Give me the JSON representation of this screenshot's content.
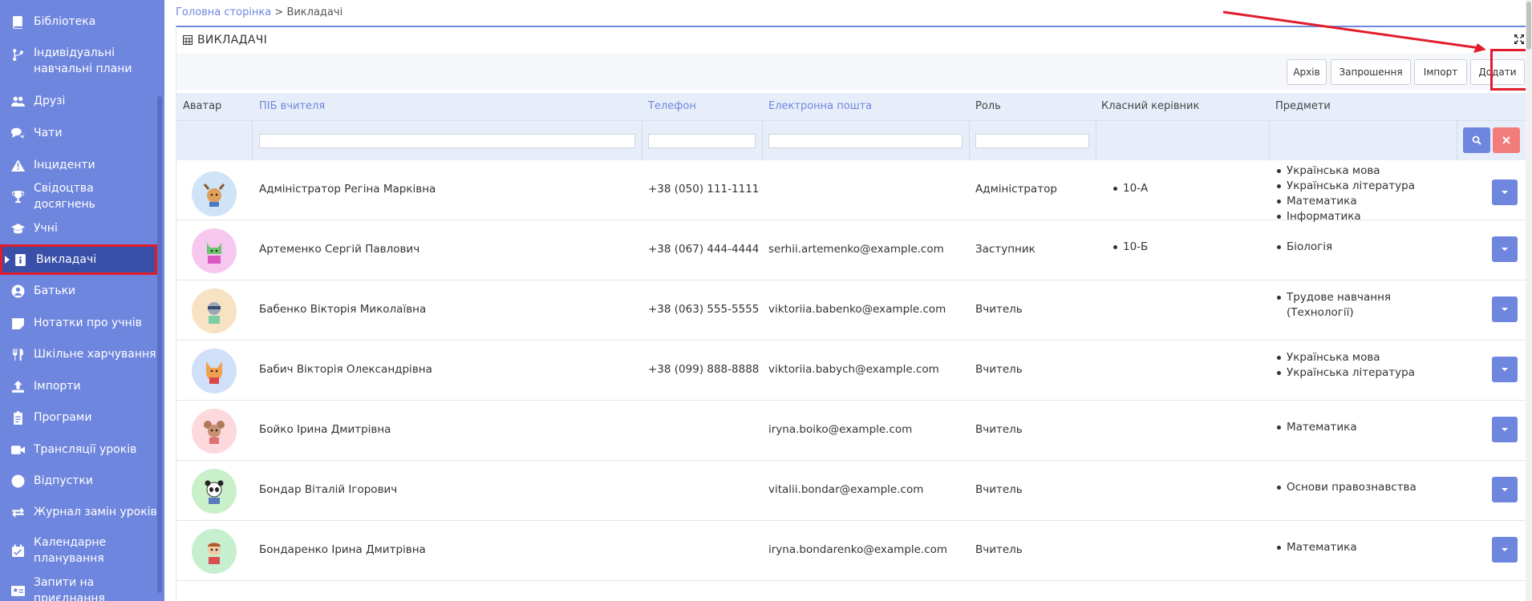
{
  "sidebar": {
    "items": [
      {
        "label": "Бібліотека",
        "icon": "book-icon"
      },
      {
        "label": "Індивідуальні навчальні плани",
        "icon": "branch-icon"
      },
      {
        "label": "Друзі",
        "icon": "users-icon"
      },
      {
        "label": "Чати",
        "icon": "chat-icon"
      },
      {
        "label": "Інциденти",
        "icon": "warning-icon"
      },
      {
        "label": "Свідоцтва досягнень",
        "icon": "trophy-icon"
      },
      {
        "label": "Учні",
        "icon": "graduation-cap-icon"
      },
      {
        "label": "Викладачі",
        "icon": "id-badge-icon"
      },
      {
        "label": "Батьки",
        "icon": "user-circle-icon"
      },
      {
        "label": "Нотатки про учнів",
        "icon": "note-icon"
      },
      {
        "label": "Шкільне харчування",
        "icon": "utensils-icon"
      },
      {
        "label": "Імпорти",
        "icon": "upload-icon"
      },
      {
        "label": "Програми",
        "icon": "clipboard-icon"
      },
      {
        "label": "Трансляції уроків",
        "icon": "video-icon"
      },
      {
        "label": "Відпустки",
        "icon": "circle-icon"
      },
      {
        "label": "Журнал замін уроків",
        "icon": "exchange-icon"
      },
      {
        "label": "Календарне планування",
        "icon": "calendar-check-icon"
      },
      {
        "label": "Запити на приєднання",
        "icon": "id-card-icon"
      }
    ]
  },
  "breadcrumb": {
    "home": "Головна сторінка",
    "separator": " > ",
    "current": "Викладачі"
  },
  "panel": {
    "title": "ВИКЛАДАЧІ"
  },
  "toolbar": {
    "archive": "Архів",
    "invitations": "Запрошення",
    "import": "Імпорт",
    "add": "Додати"
  },
  "table": {
    "headers": {
      "avatar": "Аватар",
      "name": "ПІБ вчителя",
      "phone": "Телефон",
      "email": "Електронна пошта",
      "role": "Роль",
      "class_teacher": "Класний керівник",
      "subjects": "Предмети"
    },
    "rows": [
      {
        "name": "Адміністратор Регіна Марківна",
        "phone": "+38 (050) 111-1111",
        "email": "",
        "role": "Адміністратор",
        "classes": [
          "10-А"
        ],
        "subjects": [
          "Українська мова",
          "Українська література",
          "Математика",
          "Інформатика"
        ],
        "avatar_color": "#cfe4f7"
      },
      {
        "name": "Артеменко Сергій Павлович",
        "phone": "+38 (067) 444-4444",
        "email": "serhii.artemenko@example.com",
        "role": "Заступник",
        "classes": [
          "10-Б"
        ],
        "subjects": [
          "Біологія"
        ],
        "avatar_color": "#f6c8ef"
      },
      {
        "name": "Бабенко Вікторія Миколаївна",
        "phone": "+38 (063) 555-5555",
        "email": "viktoriia.babenko@example.com",
        "role": "Вчитель",
        "classes": [],
        "subjects": [
          "Трудове навчання",
          "(Технології)"
        ],
        "avatar_color": "#f8e2c4"
      },
      {
        "name": "Бабич Вікторія Олександрівна",
        "phone": "+38 (099) 888-8888",
        "email": "viktoriia.babych@example.com",
        "role": "Вчитель",
        "classes": [],
        "subjects": [
          "Українська мова",
          "Українська література"
        ],
        "avatar_color": "#cfe0f8"
      },
      {
        "name": "Бойко Ірина Дмитрівна",
        "phone": "",
        "email": "iryna.boiko@example.com",
        "role": "Вчитель",
        "classes": [],
        "subjects": [
          "Математика"
        ],
        "avatar_color": "#fbd9dd"
      },
      {
        "name": "Бондар Віталій Ігорович",
        "phone": "",
        "email": "vitalii.bondar@example.com",
        "role": "Вчитель",
        "classes": [],
        "subjects": [
          "Основи правознавства"
        ],
        "avatar_color": "#c9f0c9"
      },
      {
        "name": "Бондаренко Ірина Дмитрівна",
        "phone": "",
        "email": "iryna.bondarenko@example.com",
        "role": "Вчитель",
        "classes": [],
        "subjects": [
          "Математика"
        ],
        "avatar_color": "#c6efd0"
      }
    ]
  },
  "colors": {
    "sidebar": "#6f86de",
    "active": "#3a50a8",
    "accent": "#6f86de",
    "highlight": "#e11d2b"
  }
}
